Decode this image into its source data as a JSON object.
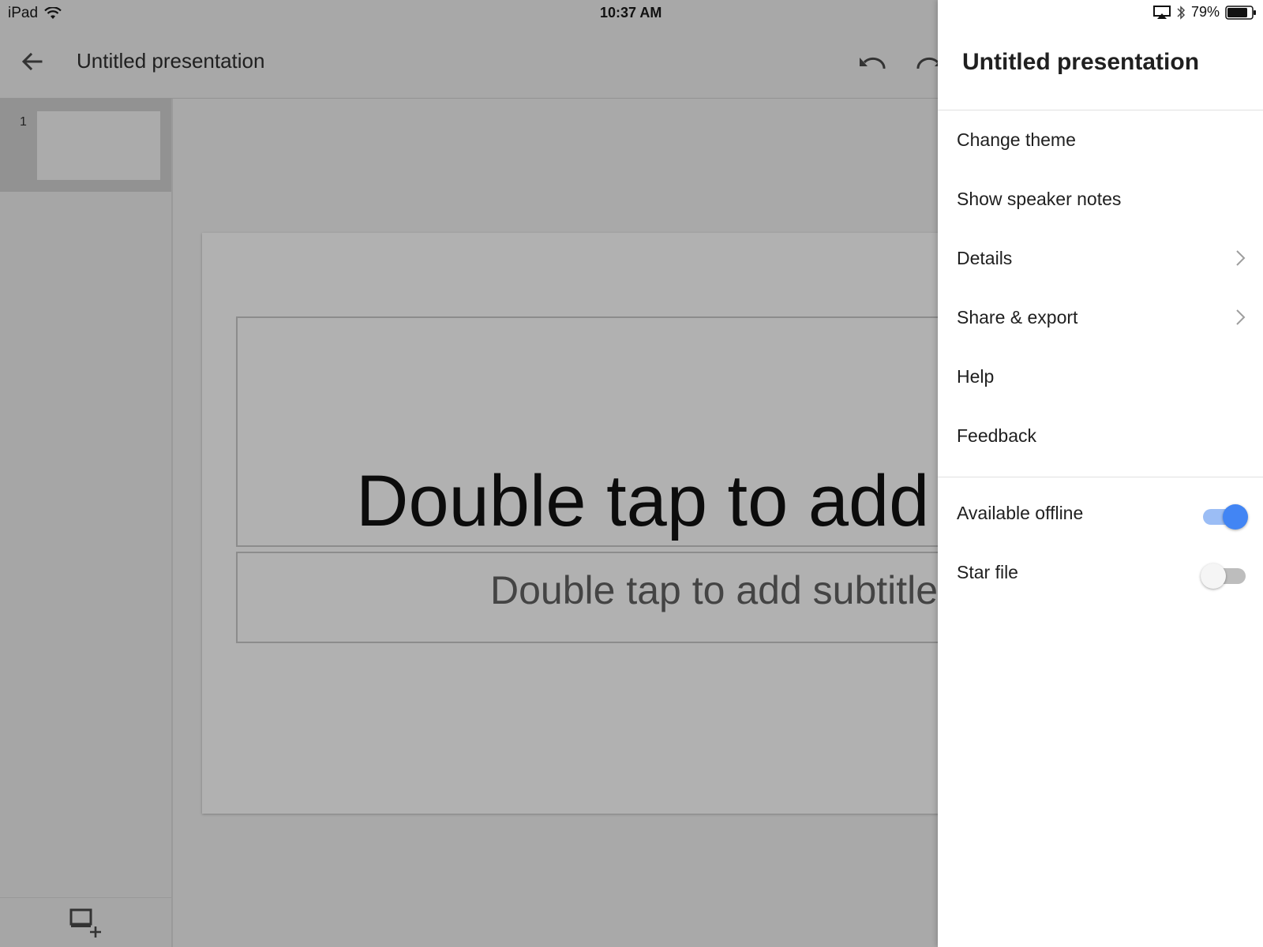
{
  "status_bar": {
    "device": "iPad",
    "time": "10:37 AM",
    "battery": "79%",
    "icons": [
      "wifi-icon",
      "airplay-icon",
      "bluetooth-icon",
      "battery-icon"
    ]
  },
  "app_bar": {
    "title": "Untitled presentation",
    "icons": [
      "back-arrow-icon",
      "undo-icon",
      "redo-icon"
    ]
  },
  "filmstrip": {
    "slides": [
      {
        "number": "1"
      }
    ],
    "footer_icon": "add-slide-icon"
  },
  "slide": {
    "title_placeholder": "Double tap to add",
    "subtitle_placeholder": "Double tap to add subtitle"
  },
  "drawer": {
    "title": "Untitled presentation",
    "menu_items": [
      {
        "label": "Change theme",
        "has_submenu": false
      },
      {
        "label": "Show speaker notes",
        "has_submenu": false
      },
      {
        "label": "Details",
        "has_submenu": true
      },
      {
        "label": "Share & export",
        "has_submenu": true
      },
      {
        "label": "Help",
        "has_submenu": false
      },
      {
        "label": "Feedback",
        "has_submenu": false
      }
    ],
    "toggles": [
      {
        "label": "Available offline",
        "state": "on"
      },
      {
        "label": "Star file",
        "state": "off"
      }
    ]
  },
  "colors": {
    "accent": "#4285f4",
    "accent_track": "#9bbdf5",
    "overlay_gray": "#a8a8a8",
    "drawer_bg": "#ffffff"
  }
}
